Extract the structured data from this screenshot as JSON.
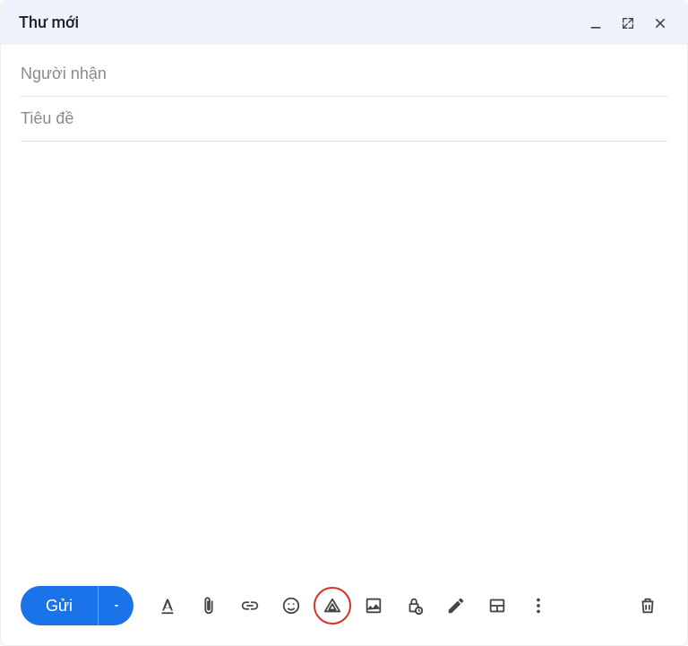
{
  "header": {
    "title": "Thư mới"
  },
  "fields": {
    "recipients_placeholder": "Người nhận",
    "subject_placeholder": "Tiêu đề"
  },
  "toolbar": {
    "send_label": "Gửi"
  }
}
